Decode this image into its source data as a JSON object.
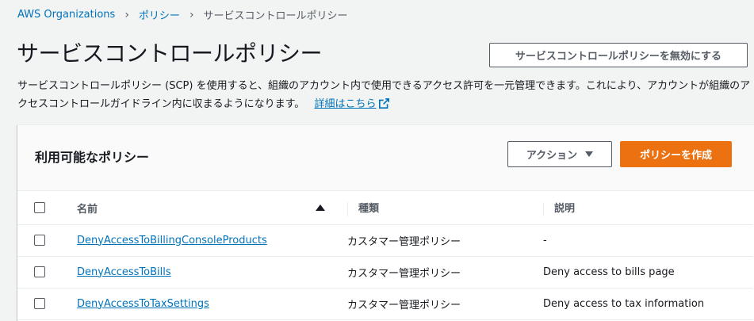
{
  "breadcrumb": {
    "items": [
      "AWS Organizations",
      "ポリシー",
      "サービスコントロールポリシー"
    ]
  },
  "page": {
    "title": "サービスコントロールポリシー",
    "disable_button": "サービスコントロールポリシーを無効にする",
    "description": "サービスコントロールポリシー (SCP) を使用すると、組織のアカウント内で使用できるアクセス許可を一元管理できます。これにより、アカウントが組織のアクセスコントロールガイドライン内に収まるようになります。",
    "learn_more": "詳細はこちら"
  },
  "panel": {
    "title": "利用可能なポリシー",
    "actions_button": "アクション",
    "create_button": "ポリシーを作成",
    "columns": {
      "name": "名前",
      "type": "種類",
      "description": "説明"
    },
    "rows": [
      {
        "name": "DenyAccessToBillingConsoleProducts",
        "type": "カスタマー管理ポリシー",
        "description": "-"
      },
      {
        "name": "DenyAccessToBills",
        "type": "カスタマー管理ポリシー",
        "description": "Deny access to bills page"
      },
      {
        "name": "DenyAccessToTaxSettings",
        "type": "カスタマー管理ポリシー",
        "description": "Deny access to tax information"
      }
    ]
  },
  "colors": {
    "link": "#0073bb",
    "primary": "#ec7211",
    "background": "#f2f3f3"
  },
  "icons": [
    "chevron-right-icon",
    "external-link-icon",
    "caret-down-icon",
    "sort-ascending-icon"
  ]
}
